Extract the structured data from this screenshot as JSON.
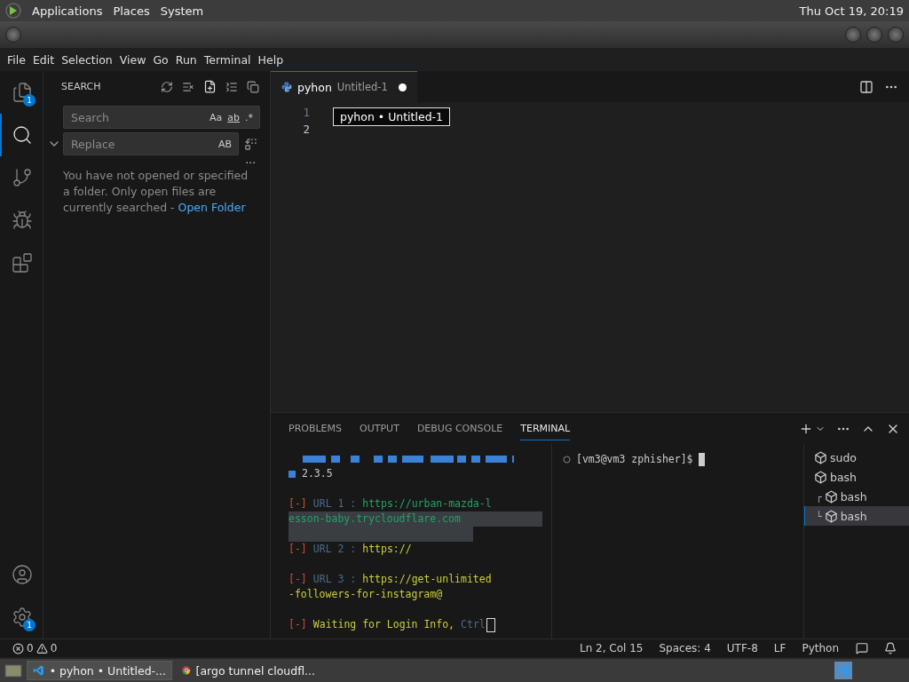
{
  "top_panel": {
    "menus": [
      "Applications",
      "Places",
      "System"
    ],
    "clock": "Thu Oct 19, 20:19"
  },
  "menu_bar": [
    "File",
    "Edit",
    "Selection",
    "View",
    "Go",
    "Run",
    "Terminal",
    "Help"
  ],
  "activity_bar": [
    {
      "kind": "explorer",
      "badge": "1",
      "selected": false
    },
    {
      "kind": "search",
      "selected": true
    },
    {
      "kind": "source-control",
      "selected": false
    },
    {
      "kind": "run",
      "selected": false
    },
    {
      "kind": "extensions",
      "selected": false
    }
  ],
  "activity_bottom": [
    {
      "kind": "account"
    },
    {
      "kind": "settings",
      "badge": "1"
    }
  ],
  "search_panel": {
    "title": "SEARCH",
    "search_placeholder": "Search",
    "search_toggles": [
      "Aa",
      "ab",
      ".*"
    ],
    "replace_placeholder": "Replace",
    "replace_toggle": "AB",
    "more": "...",
    "message": "You have not opened or specified a folder. Only open files are currently searched - ",
    "link": "Open Folder"
  },
  "editor": {
    "tabs": [
      {
        "label": "pyhon",
        "description": "Untitled-1",
        "dirty": true,
        "selected": true
      }
    ],
    "line_numbers": [
      "1",
      "2"
    ],
    "tooltip": "pyhon • Untitled-1"
  },
  "panel": {
    "tabs": [
      {
        "label": "PROBLEMS",
        "selected": false
      },
      {
        "label": "OUTPUT",
        "selected": false
      },
      {
        "label": "DEBUG CONSOLE",
        "selected": false
      },
      {
        "label": "TERMINAL",
        "selected": true
      }
    ],
    "output": [
      {
        "kind": "version",
        "text": "2.3.5"
      },
      {
        "kind": "blank"
      },
      {
        "kind": "line",
        "segments": [
          {
            "kind": "mark",
            "text": "[-]"
          },
          {
            "kind": "label",
            "text": "URL 1 :"
          },
          {
            "kind": "url",
            "text": "https://urban-mazda-l"
          }
        ]
      },
      {
        "kind": "line",
        "segments": [
          {
            "kind": "url",
            "text": "esson-baby.trycloudflare.com"
          }
        ],
        "highlight": true
      },
      {
        "kind": "blank",
        "highlight": true
      },
      {
        "kind": "line",
        "segments": [
          {
            "kind": "mark",
            "text": "[-]"
          },
          {
            "kind": "label",
            "text": "URL 2 :"
          },
          {
            "kind": "warn",
            "text": "https://"
          }
        ]
      },
      {
        "kind": "blank"
      },
      {
        "kind": "line",
        "segments": [
          {
            "kind": "mark",
            "text": "[-]"
          },
          {
            "kind": "label",
            "text": "URL 3 :"
          },
          {
            "kind": "warn",
            "text": "https://get-unlimited"
          }
        ]
      },
      {
        "kind": "line",
        "segments": [
          {
            "kind": "warn",
            "text": "-followers-for-instagram@"
          }
        ]
      },
      {
        "kind": "blank"
      },
      {
        "kind": "line",
        "segments": [
          {
            "kind": "mark",
            "text": "[-]"
          },
          {
            "kind": "warn",
            "text": "Waiting for Login Info,"
          },
          {
            "kind": "label",
            "text": "Ctrl"
          }
        ],
        "cursor": true
      }
    ],
    "prompt": "[vm3@vm3 zphisher]$",
    "terminals": [
      {
        "label": "sudo",
        "selected": false
      },
      {
        "label": "bash",
        "selected": false,
        "children": [
          {
            "label": "bash",
            "branch": "┌",
            "selected": false
          },
          {
            "label": "bash",
            "branch": "└",
            "selected": true
          }
        ]
      }
    ]
  },
  "status_bar": {
    "errors": "0",
    "warnings": "0",
    "items": [
      "Ln 2, Col 15",
      "Spaces: 4",
      "UTF-8",
      "LF",
      "Python"
    ]
  },
  "taskbar": {
    "tasks": [
      {
        "kind": "vscode",
        "label": "• pyhon • Untitled-...",
        "selected": true
      },
      {
        "kind": "browser",
        "label": "[argo tunnel cloudfl...",
        "selected": false
      }
    ]
  }
}
